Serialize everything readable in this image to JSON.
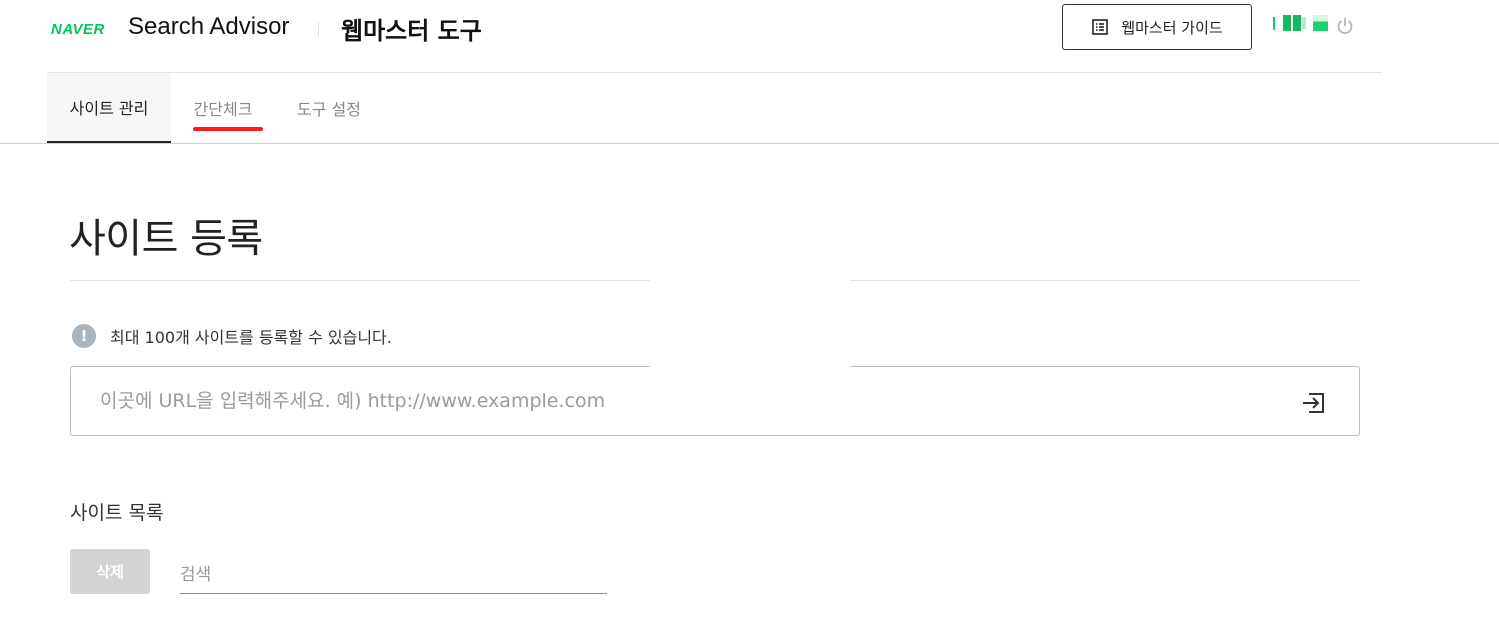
{
  "header": {
    "logo": "NAVER",
    "app_name": "Search Advisor",
    "app_sub": "웹마스터 도구",
    "guide_button_label": "웹마스터 가이드",
    "guide_icon": "document-list-icon",
    "power_icon": "power-icon"
  },
  "tabs": [
    {
      "label": "사이트 관리",
      "active": true
    },
    {
      "label": "간단체크",
      "active": false,
      "highlighted": true
    },
    {
      "label": "도구 설정",
      "active": false
    }
  ],
  "main": {
    "title": "사이트 등록",
    "notice": "최대 100개 사이트를 등록할 수 있습니다.",
    "notice_icon": "exclamation-icon",
    "notice_symbol": "!",
    "url_placeholder": "이곳에 URL을 입력해주세요. 예) http://www.example.com",
    "submit_icon": "enter-arrow-icon",
    "list_title": "사이트 목록",
    "delete_label": "삭제",
    "search_placeholder": "검색"
  },
  "colors": {
    "brand_green": "#03c75a",
    "highlight_red": "#ff1a1a",
    "disabled_gray": "#d3d3d3"
  }
}
